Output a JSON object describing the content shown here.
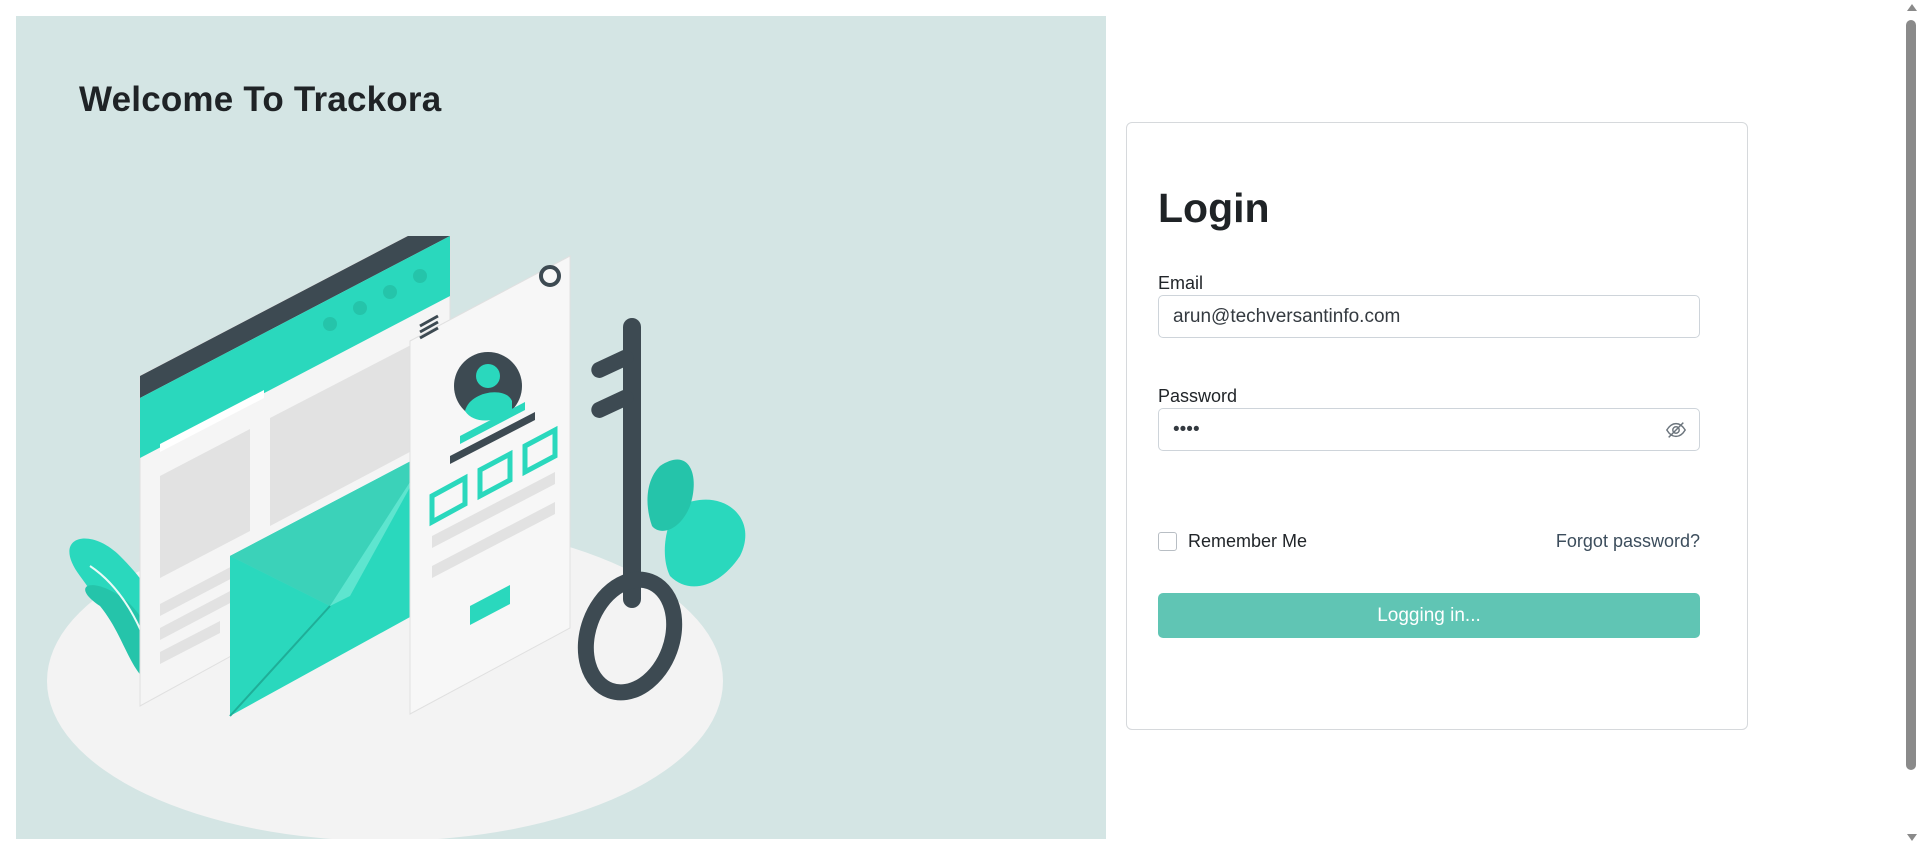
{
  "hero": {
    "title": "Welcome To Trackora",
    "illustration_icon": "login-illustration",
    "background_color": "#d4e5e4",
    "accent_color": "#2ad8bd"
  },
  "login": {
    "title": "Login",
    "email_label": "Email",
    "email_value": "arun@techversantinfo.com",
    "password_label": "Password",
    "password_value": "••••",
    "password_toggle_icon": "eye-slash-icon",
    "remember_label": "Remember Me",
    "remember_checked": false,
    "forgot_label": "Forgot password?",
    "submit_label": "Logging in...",
    "submit_color": "#60c5b4"
  }
}
